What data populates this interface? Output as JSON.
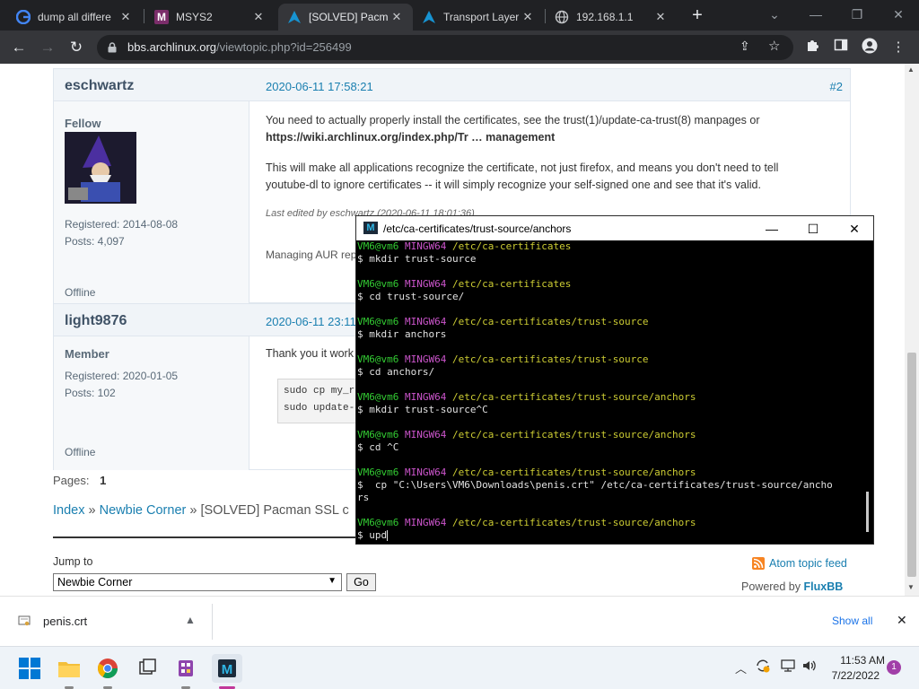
{
  "browser": {
    "tabs": [
      {
        "title": "dump all differe",
        "icon": "google-icon"
      },
      {
        "title": "MSYS2",
        "icon": "msys2-icon"
      },
      {
        "title": "[SOLVED] Pacm",
        "icon": "arch-icon",
        "active": true
      },
      {
        "title": "Transport Layer",
        "icon": "arch-icon"
      },
      {
        "title": "192.168.1.1",
        "icon": "globe-icon"
      }
    ],
    "new_tab": "+",
    "url_host": "bbs.archlinux.org",
    "url_path": "/viewtopic.php?id=256499"
  },
  "forum": {
    "posts": [
      {
        "author": "eschwartz",
        "date": "2020-06-11 17:58:21",
        "number": "#2",
        "rank": "Fellow",
        "registered": "Registered: 2014-08-08",
        "posts": "Posts: 4,097",
        "status": "Offline",
        "body1": "You need to actually properly install the certificates, see the trust(1)/update-ca-trust(8) manpages or",
        "link": "https://wiki.archlinux.org/index.php/Tr … management",
        "body2": "This will make all applications recognize the certificate, not just firefox, and means you don't need to tell",
        "body3": "youtube-dl to ignore certificates -- it will simply recognize your self-signed one and see that it's valid.",
        "edited": "Last edited by eschwartz (2020-06-11 18:01:36)",
        "signature": "Managing AUR rep"
      },
      {
        "author": "light9876",
        "date": "2020-06-11 23:11",
        "rank": "Member",
        "registered": "Registered: 2020-01-05",
        "posts": "Posts: 102",
        "status": "Offline",
        "body": "Thank you it work",
        "code1": "sudo cp my_roo",
        "code2": "sudo update-c"
      }
    ],
    "pages_label": "Pages:",
    "pages_current": "1",
    "breadcrumb": [
      "Index",
      "»",
      "Newbie Corner",
      "»",
      "[SOLVED] Pacman SSL c"
    ],
    "jump_label": "Jump to",
    "jump_selected": "Newbie Corner",
    "go_label": "Go",
    "atom_feed": "Atom topic feed",
    "powered_by": "Powered by",
    "fluxbb": "FluxBB"
  },
  "terminal": {
    "title": "/etc/ca-certificates/trust-source/anchors",
    "lines": [
      {
        "user": "VM6@vm6",
        "host": "MINGW64",
        "path": "/etc/ca-certificates"
      },
      {
        "cmd": "$ mkdir trust-source"
      },
      {
        "cmd": ""
      },
      {
        "user": "VM6@vm6",
        "host": "MINGW64",
        "path": "/etc/ca-certificates"
      },
      {
        "cmd": "$ cd trust-source/"
      },
      {
        "cmd": ""
      },
      {
        "user": "VM6@vm6",
        "host": "MINGW64",
        "path": "/etc/ca-certificates/trust-source"
      },
      {
        "cmd": "$ mkdir anchors"
      },
      {
        "cmd": ""
      },
      {
        "user": "VM6@vm6",
        "host": "MINGW64",
        "path": "/etc/ca-certificates/trust-source"
      },
      {
        "cmd": "$ cd anchors/"
      },
      {
        "cmd": ""
      },
      {
        "user": "VM6@vm6",
        "host": "MINGW64",
        "path": "/etc/ca-certificates/trust-source/anchors"
      },
      {
        "cmd": "$ mkdir trust-source^C"
      },
      {
        "cmd": ""
      },
      {
        "user": "VM6@vm6",
        "host": "MINGW64",
        "path": "/etc/ca-certificates/trust-source/anchors"
      },
      {
        "cmd": "$ cd ^C"
      },
      {
        "cmd": ""
      },
      {
        "user": "VM6@vm6",
        "host": "MINGW64",
        "path": "/etc/ca-certificates/trust-source/anchors"
      },
      {
        "cmd": "$  cp \"C:\\Users\\VM6\\Downloads\\penis.crt\" /etc/ca-certificates/trust-source/ancho"
      },
      {
        "cmd": "rs"
      },
      {
        "cmd": ""
      },
      {
        "user": "VM6@vm6",
        "host": "MINGW64",
        "path": "/etc/ca-certificates/trust-source/anchors"
      },
      {
        "cmd": "$ upd"
      }
    ]
  },
  "downloads": {
    "file": "penis.crt",
    "show_all": "Show all"
  },
  "taskbar": {
    "time": "11:53 AM",
    "date": "7/22/2022",
    "notifications": "1"
  },
  "colors": {
    "link": "#1a7fb0",
    "terminal_user": "#33cc33",
    "terminal_host": "#cc55cc",
    "terminal_path": "#cccc33"
  }
}
